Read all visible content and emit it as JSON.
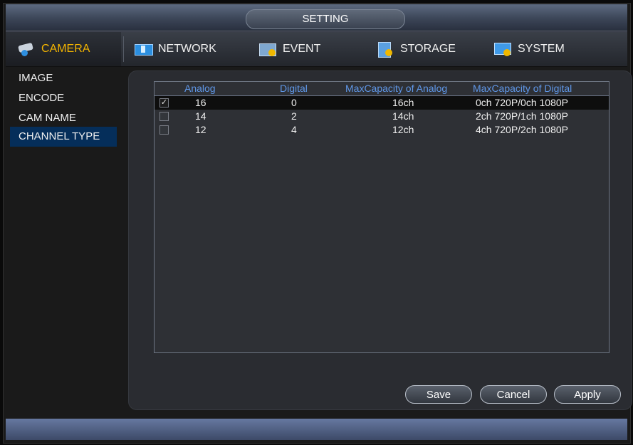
{
  "window": {
    "title": "SETTING"
  },
  "tabs": [
    {
      "label": "CAMERA",
      "icon": "camera-icon",
      "active": true
    },
    {
      "label": "NETWORK",
      "icon": "network-icon",
      "active": false
    },
    {
      "label": "EVENT",
      "icon": "event-icon",
      "active": false
    },
    {
      "label": "STORAGE",
      "icon": "storage-icon",
      "active": false
    },
    {
      "label": "SYSTEM",
      "icon": "system-icon",
      "active": false
    }
  ],
  "sidebar": {
    "items": [
      {
        "label": "IMAGE",
        "selected": false
      },
      {
        "label": "ENCODE",
        "selected": false
      },
      {
        "label": "CAM NAME",
        "selected": false
      },
      {
        "label": "CHANNEL TYPE",
        "selected": true
      }
    ]
  },
  "table": {
    "columns": [
      "Analog",
      "Digital",
      "MaxCapacity of Analog",
      "MaxCapacity of Digital"
    ],
    "rows": [
      {
        "checked": true,
        "analog": "16",
        "digital": "0",
        "max_analog": "16ch",
        "max_digital": "0ch 720P/0ch 1080P"
      },
      {
        "checked": false,
        "analog": "14",
        "digital": "2",
        "max_analog": "14ch",
        "max_digital": "2ch 720P/1ch 1080P"
      },
      {
        "checked": false,
        "analog": "12",
        "digital": "4",
        "max_analog": "12ch",
        "max_digital": "4ch 720P/2ch 1080P"
      }
    ]
  },
  "buttons": {
    "save": "Save",
    "cancel": "Cancel",
    "apply": "Apply"
  },
  "glyphs": {
    "check": "✓"
  },
  "colors": {
    "accent": "#f3b400",
    "header_text": "#5f97e8",
    "selection": "#052e5a"
  }
}
